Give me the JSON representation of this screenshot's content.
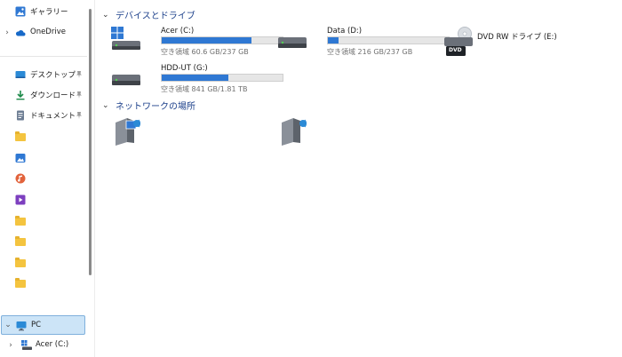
{
  "sidebar": {
    "gallery": "ギャラリー",
    "onedrive": "OneDrive",
    "desktop": "デスクトップ",
    "downloads": "ダウンロード",
    "documents": "ドキュメント",
    "pc": "PC",
    "acer": "Acer (C:)"
  },
  "main": {
    "devices_header": "デバイスとドライブ",
    "network_header": "ネットワークの場所",
    "drives": [
      {
        "name": "Acer (C:)",
        "info": "空き領域 60.6 GB/237 GB",
        "used_fraction": 0.74
      },
      {
        "name": "Data (D:)",
        "info": "空き領域 216 GB/237 GB",
        "used_fraction": 0.09
      },
      {
        "name": "DVD RW ドライブ (E:)",
        "label": "DVD"
      },
      {
        "name": "HDD-UT (G:)",
        "info": "空き領域 841 GB/1.81 TB",
        "used_fraction": 0.55
      }
    ]
  },
  "colors": {
    "accent": "#2f78d3",
    "header_blue": "#1b3f8a",
    "selection": "#cce4f7"
  }
}
